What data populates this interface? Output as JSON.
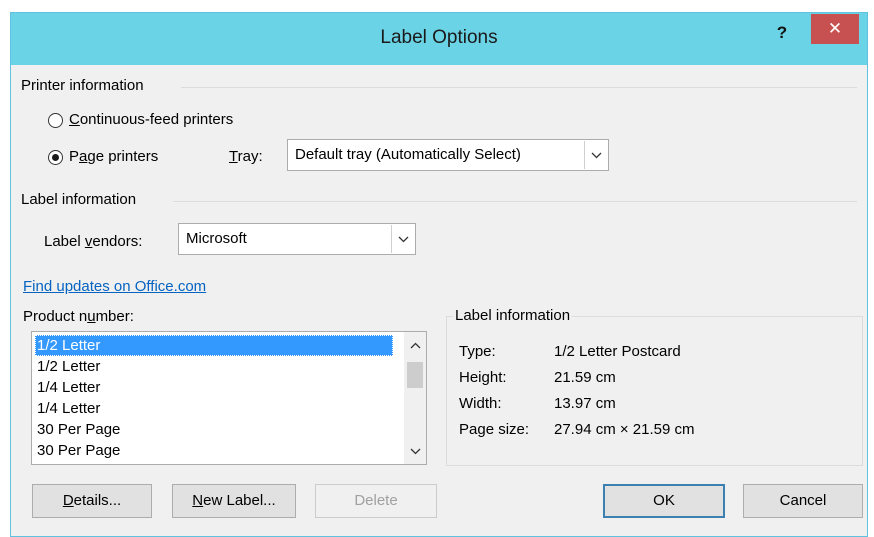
{
  "dialog": {
    "title": "Label Options",
    "help_label": "?",
    "close_label": "✕"
  },
  "printer_info": {
    "group_title": "Printer information",
    "continuous_pre": "",
    "continuous_access": "C",
    "continuous_rest": "ontinuous-feed printers",
    "page_pre": "P",
    "page_access": "a",
    "page_rest": "ge printers",
    "selected": "page",
    "tray_access": "T",
    "tray_rest": "ray:",
    "tray_value": "Default tray (Automatically Select)"
  },
  "label_info_section": {
    "group_title": "Label information",
    "vendors_pre": "Label ",
    "vendors_access": "v",
    "vendors_rest": "endors:",
    "vendors_value": "Microsoft"
  },
  "updates_link": "Find updates on Office.com",
  "product": {
    "label_pre": "Product n",
    "label_access": "u",
    "label_rest": "mber:",
    "items": [
      "1/2 Letter",
      "1/2 Letter",
      "1/4 Letter",
      "1/4 Letter",
      "30 Per Page",
      "30 Per Page"
    ],
    "selected_index": 0
  },
  "label_details": {
    "group_title": "Label information",
    "type_label": "Type:",
    "type_value": "1/2 Letter Postcard",
    "height_label": "Height:",
    "height_value": "21.59 cm",
    "width_label": "Width:",
    "width_value": "13.97 cm",
    "pagesize_label": "Page size:",
    "pagesize_value": "27.94 cm × 21.59 cm"
  },
  "buttons": {
    "details_access": "D",
    "details_rest": "etails...",
    "newlabel_access": "N",
    "newlabel_rest": "ew Label...",
    "delete": "Delete",
    "ok": "OK",
    "cancel": "Cancel"
  },
  "icons": {
    "dropdown": "chevron-down-icon",
    "scroll_up": "chevron-up-icon",
    "scroll_down": "chevron-down-icon"
  },
  "colors": {
    "titlebar": "#6bd3e6",
    "close": "#c75050",
    "selection": "#3399ff",
    "link": "#0563c1"
  }
}
